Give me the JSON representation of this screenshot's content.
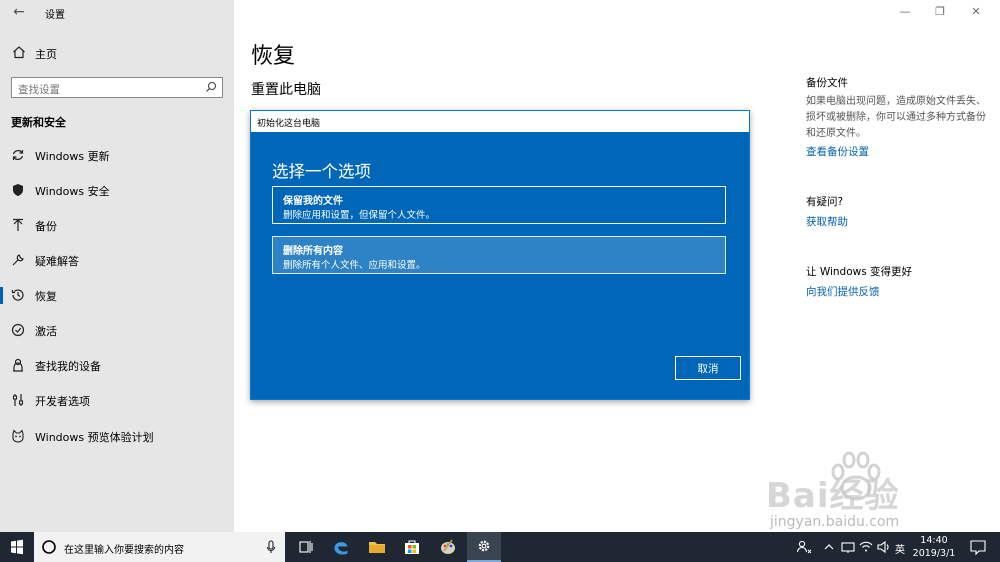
{
  "window": {
    "title": "设置"
  },
  "sidebar": {
    "home": "主页",
    "search_placeholder": "查找设置",
    "section": "更新和安全",
    "items": [
      {
        "label": "Windows 更新",
        "icon": "refresh-icon"
      },
      {
        "label": "Windows 安全",
        "icon": "shield-icon"
      },
      {
        "label": "备份",
        "icon": "backup-arrow-icon"
      },
      {
        "label": "疑难解答",
        "icon": "wrench-icon"
      },
      {
        "label": "恢复",
        "icon": "history-icon",
        "selected": true
      },
      {
        "label": "激活",
        "icon": "check-circle-icon"
      },
      {
        "label": "查找我的设备",
        "icon": "person-location-icon"
      },
      {
        "label": "开发者选项",
        "icon": "developer-sliders-icon"
      },
      {
        "label": "Windows 预览体验计划",
        "icon": "insider-cat-icon"
      }
    ]
  },
  "main": {
    "title": "恢复",
    "subtitle": "重置此电脑"
  },
  "dialog": {
    "title": "初始化这台电脑",
    "heading": "选择一个选项",
    "options": [
      {
        "title": "保留我的文件",
        "desc": "删除应用和设置，但保留个人文件。"
      },
      {
        "title": "删除所有内容",
        "desc": "删除所有个人文件、应用和设置。"
      }
    ],
    "cancel": "取消"
  },
  "right_panel": {
    "backup_heading": "备份文件",
    "backup_text": "如果电脑出现问题，造成原始文件丢失、损坏或被删除，你可以通过多种方式备份和还原文件。",
    "backup_link": "查看备份设置",
    "question_heading": "有疑问?",
    "help_link": "获取帮助",
    "improve_heading": "让 Windows 变得更好",
    "feedback_link": "向我们提供反馈"
  },
  "taskbar": {
    "search_text": "在这里输入你要搜索的内容",
    "ime": "英",
    "time": "14:40",
    "date": "2019/3/1"
  },
  "watermark": {
    "text": "Bai经验",
    "url": "jingyan.baidu.com"
  },
  "colors": {
    "accent": "#0063b1",
    "dialog_bg": "#0067b8",
    "sidebar_bg": "#e6e6e6",
    "taskbar_bg": "#1f2733"
  }
}
